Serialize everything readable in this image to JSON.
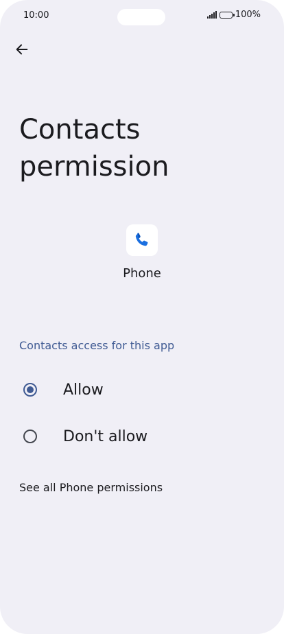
{
  "status_bar": {
    "time": "10:00",
    "battery_text": "100%",
    "icons": [
      "signal-icon",
      "battery-icon"
    ]
  },
  "header": {
    "back_icon": "arrow-left-icon",
    "title": "Contacts permission"
  },
  "app": {
    "name": "Phone",
    "icon": "phone-handset-icon"
  },
  "permission": {
    "section_header": "Contacts access for this app",
    "options": [
      {
        "label": "Allow",
        "selected": true
      },
      {
        "label": "Don't allow",
        "selected": false
      }
    ]
  },
  "footer_link": "See all Phone permissions",
  "colors": {
    "background": "#f0eff6",
    "accent": "#3f5a93",
    "text": "#1b1b1f",
    "phone_icon_blue": "#1a6fe0"
  }
}
